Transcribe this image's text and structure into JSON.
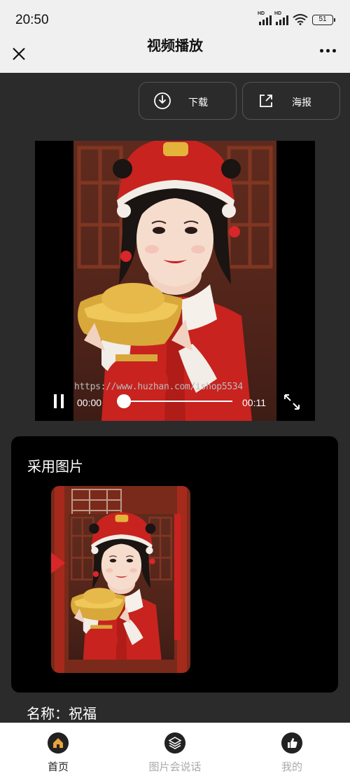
{
  "status": {
    "time": "20:50",
    "battery": "51",
    "hd": "HD"
  },
  "header": {
    "title": "视频播放"
  },
  "actions": {
    "download": "下载",
    "poster": "海报"
  },
  "player": {
    "watermark": "https://www.huzhan.com/ishop5534",
    "current_time": "00:00",
    "total_time": "00:11",
    "progress": 0
  },
  "card": {
    "title": "采用图片"
  },
  "name": {
    "label": "名称：",
    "value": "祝福"
  },
  "tabs": [
    {
      "label": "首页",
      "icon": "home-icon",
      "active": true
    },
    {
      "label": "图片会说话",
      "icon": "layers-icon",
      "active": false
    },
    {
      "label": "我的",
      "icon": "thumbs-up-icon",
      "active": false
    }
  ],
  "colors": {
    "accent": "#e8a33a",
    "dark_bg": "#2b2b2b",
    "card_bg": "#000000",
    "header_bg": "#f0f0f0",
    "costume_red": "#c8231f",
    "gold": "#d8a83a"
  }
}
